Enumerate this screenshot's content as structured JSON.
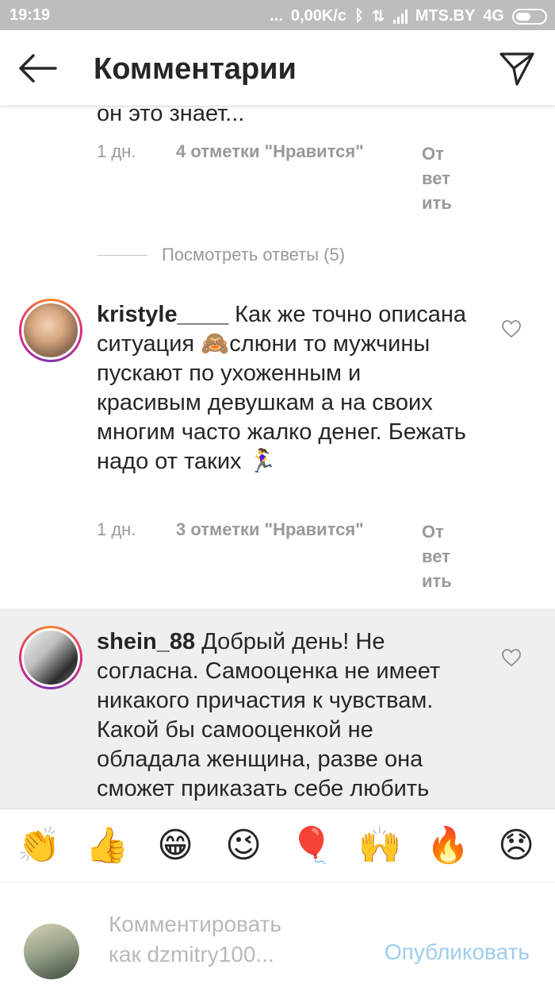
{
  "status_bar": {
    "time": "19:19",
    "dots": "...",
    "speed": "0,00K/c",
    "carrier": "MTS.BY",
    "network": "4G"
  },
  "header": {
    "title": "Комментарии"
  },
  "thread": {
    "tail_text": "он это знает...",
    "tail_meta": {
      "time": "1 дн.",
      "likes": "4 отметки \"Нравится\"",
      "reply_lines": [
        "От",
        "вет",
        "ить"
      ]
    },
    "view_replies": "Посмотреть ответы (5)"
  },
  "comments": [
    {
      "username": "kristyle____",
      "text": " Как же точно описана ситуация 🙈слюни то мужчины пускают по ухоженным и красивым девушкам а на своих многим часто жалко денег. Бежать надо от таких 🏃‍♀",
      "time": "1 дн.",
      "likes": "3 отметки \"Нравится\"",
      "reply_lines": [
        "От",
        "вет",
        "ить"
      ]
    },
    {
      "username": "shein_88",
      "text": " Добрый день! Не согласна. Самооценка не имеет никакого причастия к чувствам. Какой бы самооценкой не обладала женщина, разве она сможет приказать себе любить"
    }
  ],
  "emoji_bar": [
    "👏",
    "👍",
    "😁",
    "😉",
    "🎈",
    "🙌",
    "🔥",
    "😞"
  ],
  "composer": {
    "placeholder_line1": "Комментировать",
    "placeholder_line2": "как dzmitry100...",
    "publish": "Опубликовать"
  },
  "colors": {
    "status_bar": "#bdbdbd",
    "meta_text": "#999999",
    "publish_disabled": "#9fcdee",
    "highlight_bg": "#efefef"
  }
}
